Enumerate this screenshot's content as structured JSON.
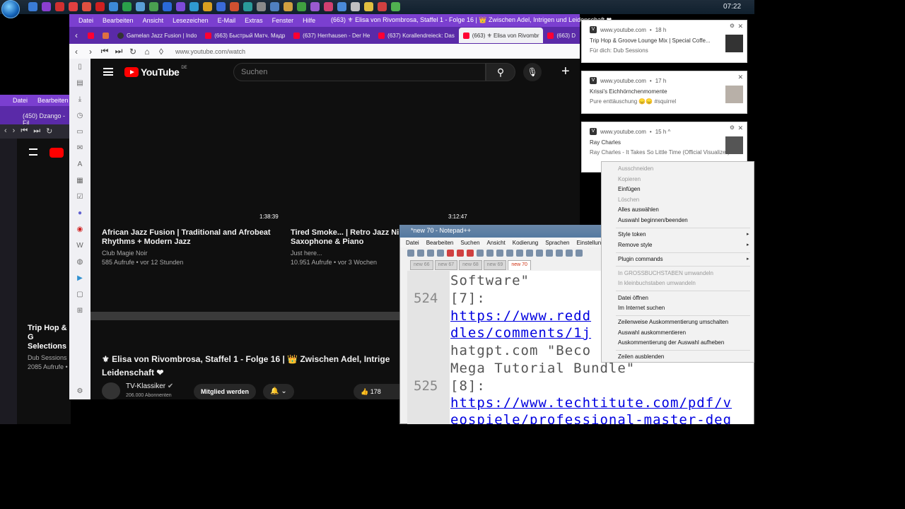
{
  "taskbar": {
    "clock": "07:22"
  },
  "bg_browser": {
    "menu": [
      "Datei",
      "Bearbeiten"
    ],
    "tab": "(450) Dzango - Fil",
    "card_title": "Trip Hop & G Selections",
    "card_channel": "Dub Sessions",
    "card_views": "2085 Aufrufe •"
  },
  "browser": {
    "menu": [
      "Datei",
      "Bearbeiten",
      "Ansicht",
      "Lesezeichen",
      "E-Mail",
      "Extras",
      "Fenster",
      "Hilfe"
    ],
    "window_title": "(663) ⚜ Elisa von Rivombrosa, Staffel 1 - Folge 16 | 👑 Zwischen Adel, Intrigen und Leidenschaft ❤ ...",
    "tabs": [
      "Gamelan Jazz Fusion | Indo",
      "(663) Быстрый Матч. Мадр",
      "(637) Herrhausen - Der He",
      "(637) Korallendreieck: Das",
      "(663) ⚜ Elisa von Rivombr",
      "(663) D"
    ],
    "url": "www.youtube.com/watch"
  },
  "youtube": {
    "logo": "YouTube",
    "region": "DE",
    "search_placeholder": "Suchen",
    "videos": [
      {
        "duration": "1:38:39",
        "title": "African Jazz Fusion | Traditional and Afrobeat Rhythms + Modern Jazz",
        "channel": "Club Magie Noir",
        "meta": "585 Aufrufe • vor 12 Stunden"
      },
      {
        "duration": "3:12:47",
        "title": "Tired Smoke... | Retro Jazz Ni Saxophone & Piano",
        "channel": "Just here...",
        "meta": "10.951 Aufrufe • vor 3 Wochen"
      }
    ],
    "watch_title": "⚜ Elisa von Rivombrosa, Staffel 1 - Folge 16 | 👑 Zwischen Adel, Intrige Leidenschaft ❤",
    "channel_name": "TV-Klassiker",
    "subscribers": "206.000 Abonnenten",
    "member_button": "Mitglied werden",
    "likes": "178"
  },
  "notepad": {
    "title": "*new 70 - Notepad++",
    "menu": [
      "Datei",
      "Bearbeiten",
      "Suchen",
      "Ansicht",
      "Kodierung",
      "Sprachen",
      "Einstellunge"
    ],
    "tabs": [
      "new 66",
      "new 67",
      "new 68",
      "new 69",
      "new 70"
    ],
    "lines": [
      {
        "num": "",
        "text": "Software\""
      },
      {
        "num": "524",
        "text": "[7]:"
      },
      {
        "num": "",
        "text": "https://www.redd"
      },
      {
        "num": "",
        "text": "dles/comments/1j"
      },
      {
        "num": "",
        "text": "hatgpt.com \"Beco"
      },
      {
        "num": "",
        "text": "Mega Tutorial Bundle\""
      },
      {
        "num": "525",
        "text": "[8]:"
      },
      {
        "num": "",
        "text": "https://www.techtitute.com/pdf/v"
      },
      {
        "num": "",
        "text": "eospiele/professional-master-deg"
      }
    ]
  },
  "notifications": [
    {
      "source": "www.youtube.com",
      "age": "18 h",
      "title": "Trip Hop & Groove Lounge Mix | Special Coffe...",
      "body": "Für dich: Dub Sessions"
    },
    {
      "source": "www.youtube.com",
      "age": "17 h",
      "title": "Krissi's Eichhörnchenmomente",
      "body": "Pure enttäuschung 😞😞 #squirrel"
    },
    {
      "source": "www.youtube.com",
      "age": "15 h ^",
      "title": "Ray Charles",
      "body": "Ray Charles - It Takes So Little Time (Official Visualizer)"
    }
  ],
  "context_menu": [
    {
      "label": "Ausschneiden",
      "disabled": true
    },
    {
      "label": "Kopieren",
      "disabled": true
    },
    {
      "label": "Einfügen",
      "disabled": false
    },
    {
      "label": "Löschen",
      "disabled": true
    },
    {
      "label": "Alles auswählen",
      "disabled": false
    },
    {
      "label": "Auswahl beginnen/beenden",
      "disabled": false
    },
    {
      "label": "Style token",
      "disabled": false
    },
    {
      "label": "Remove style",
      "disabled": false
    },
    {
      "label": "Plugin commands",
      "disabled": false
    },
    {
      "label": "In GROSSBUCHSTABEN umwandeln",
      "disabled": true
    },
    {
      "label": "In kleinbuchstaben umwandeln",
      "disabled": true
    },
    {
      "label": "Datei öffnen",
      "disabled": false
    },
    {
      "label": "Im Internet suchen",
      "disabled": false
    },
    {
      "label": "Zeilenweise Auskommentierung umschalten",
      "disabled": false
    },
    {
      "label": "Auswahl auskommentieren",
      "disabled": false
    },
    {
      "label": "Auskommentierung der Auswahl aufheben",
      "disabled": false
    },
    {
      "label": "Zeilen ausblenden",
      "disabled": false
    }
  ]
}
